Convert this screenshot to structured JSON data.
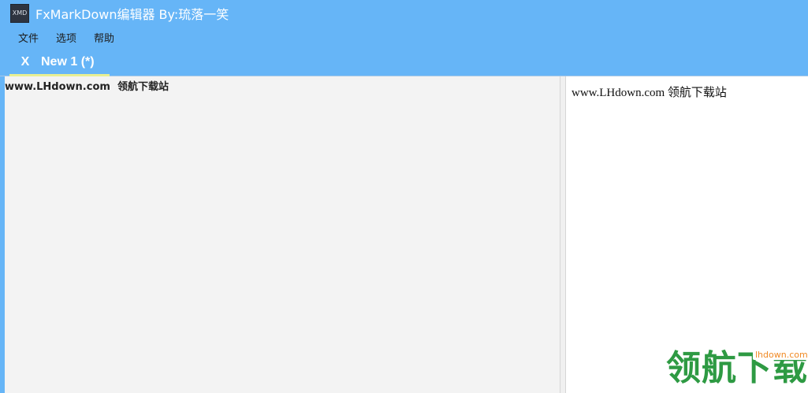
{
  "titlebar": {
    "icon_text": "XMD",
    "title": "FxMarkDown编辑器  By:琉落一笑"
  },
  "menu": {
    "items": [
      {
        "label": "文件"
      },
      {
        "label": "选项"
      },
      {
        "label": "帮助"
      }
    ]
  },
  "tabs": [
    {
      "close": "X",
      "label": "New 1 (*)"
    }
  ],
  "editor": {
    "content": "www.LHdown.com  领航下载站"
  },
  "preview": {
    "content": "www.LHdown.com 领航下载站"
  },
  "watermark": {
    "main": "领航下载",
    "site": "lhdown.com"
  },
  "colors": {
    "accent": "#66b5f7",
    "tab_underline": "#e7ef93",
    "watermark_green": "#2e9a43",
    "watermark_orange": "#f08a24"
  }
}
